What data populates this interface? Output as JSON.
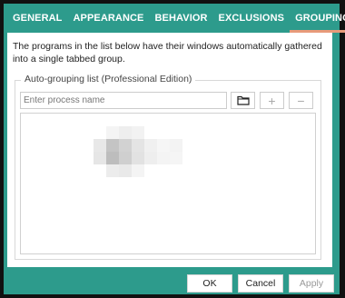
{
  "tabs": [
    {
      "label": "GENERAL"
    },
    {
      "label": "APPEARANCE"
    },
    {
      "label": "BEHAVIOR"
    },
    {
      "label": "EXCLUSIONS"
    },
    {
      "label": "GROUPING",
      "active": true
    }
  ],
  "description": "The programs in the list below have their windows automatically gathered into a single tabbed group.",
  "group": {
    "title": "Auto-grouping list (Professional Edition)",
    "process_input": {
      "value": "",
      "placeholder": "Enter process name"
    },
    "browse_icon": "folder-icon",
    "add_label": "+",
    "remove_label": "−"
  },
  "footer": {
    "ok_label": "OK",
    "cancel_label": "Cancel",
    "apply_label": "Apply"
  },
  "colors": {
    "accent": "#2d9b8c",
    "active_tab_underline": "#e89a7a"
  }
}
